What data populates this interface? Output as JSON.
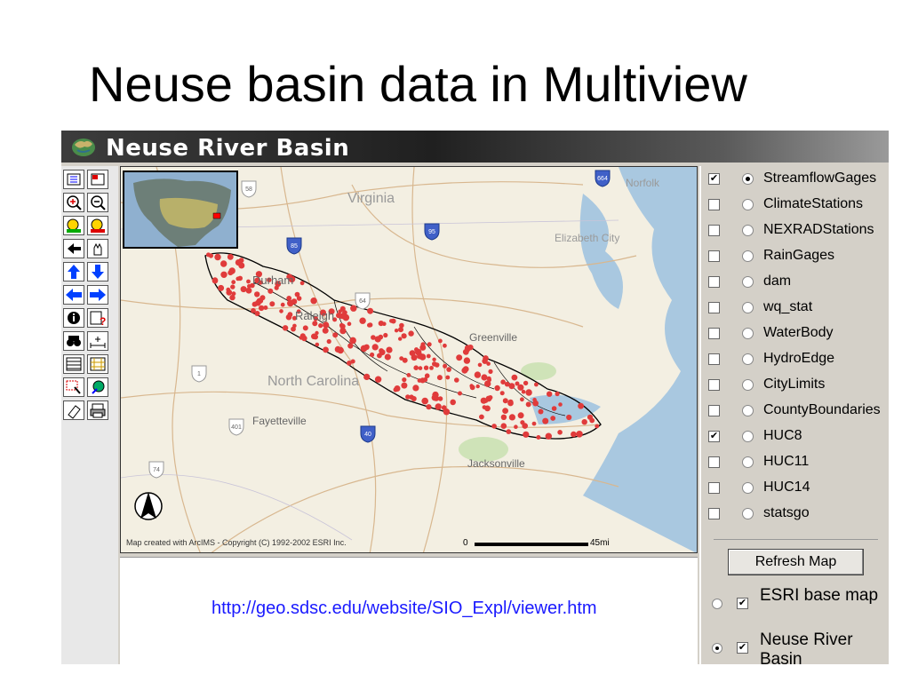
{
  "slide": {
    "title": "Neuse basin data in Multiview"
  },
  "app": {
    "title": "Neuse River Basin"
  },
  "toolbar": {
    "tools": [
      "legend-icon",
      "overview-icon",
      "zoom-in-icon",
      "zoom-out-icon",
      "zoom-full-icon",
      "zoom-active-icon",
      "back-icon",
      "pan-icon",
      "pan-north-icon",
      "pan-south-icon",
      "pan-west-icon",
      "pan-east-icon",
      "identify-icon",
      "hyperlink-icon",
      "find-icon",
      "measure-icon",
      "buffer-icon",
      "select-rectangle-icon",
      "select-by-line-icon",
      "query-icon",
      "clear-selection-icon",
      "print-icon"
    ]
  },
  "map": {
    "labels": {
      "virginia": "Virginia",
      "norfolk": "Norfolk",
      "elizabeth_city": "Elizabeth City",
      "durham": "Durham",
      "raleigh": "Raleigh",
      "greenville": "Greenville",
      "north_carolina": "North Carolina",
      "fayetteville": "Fayetteville",
      "jacksonville": "Jacksonville"
    },
    "shields": [
      "85",
      "95",
      "664",
      "40",
      "64",
      "401",
      "74",
      "1",
      "58"
    ],
    "copyright": "Map created with ArcIMS - Copyright (C) 1992-2002 ESRI Inc.",
    "scale_start": "0",
    "scale_end": "45mi",
    "colors": {
      "water": "#a9c8e0",
      "land": "#f3efe2",
      "gage_dot": "#e03b3b",
      "basin_outline": "#000000"
    }
  },
  "info": {
    "url": "http://geo.sdsc.edu/website/SIO_Expl/viewer.htm"
  },
  "layers": [
    {
      "label": "StreamflowGages",
      "checked": true,
      "active": true
    },
    {
      "label": "ClimateStations",
      "checked": false,
      "active": false
    },
    {
      "label": "NEXRADStations",
      "checked": false,
      "active": false
    },
    {
      "label": "RainGages",
      "checked": false,
      "active": false
    },
    {
      "label": "dam",
      "checked": false,
      "active": false
    },
    {
      "label": "wq_stat",
      "checked": false,
      "active": false
    },
    {
      "label": "WaterBody",
      "checked": false,
      "active": false
    },
    {
      "label": "HydroEdge",
      "checked": false,
      "active": false
    },
    {
      "label": "CityLimits",
      "checked": false,
      "active": false
    },
    {
      "label": "CountyBoundaries",
      "checked": false,
      "active": false
    },
    {
      "label": "HUC8",
      "checked": true,
      "active": false
    },
    {
      "label": "HUC11",
      "checked": false,
      "active": false
    },
    {
      "label": "HUC14",
      "checked": false,
      "active": false
    },
    {
      "label": "statsgo",
      "checked": false,
      "active": false
    }
  ],
  "refresh_label": "Refresh Map",
  "base_layers": [
    {
      "label": "ESRI base map",
      "checked": true,
      "active": false
    },
    {
      "label": "Neuse River Basin",
      "checked": true,
      "active": true
    }
  ]
}
